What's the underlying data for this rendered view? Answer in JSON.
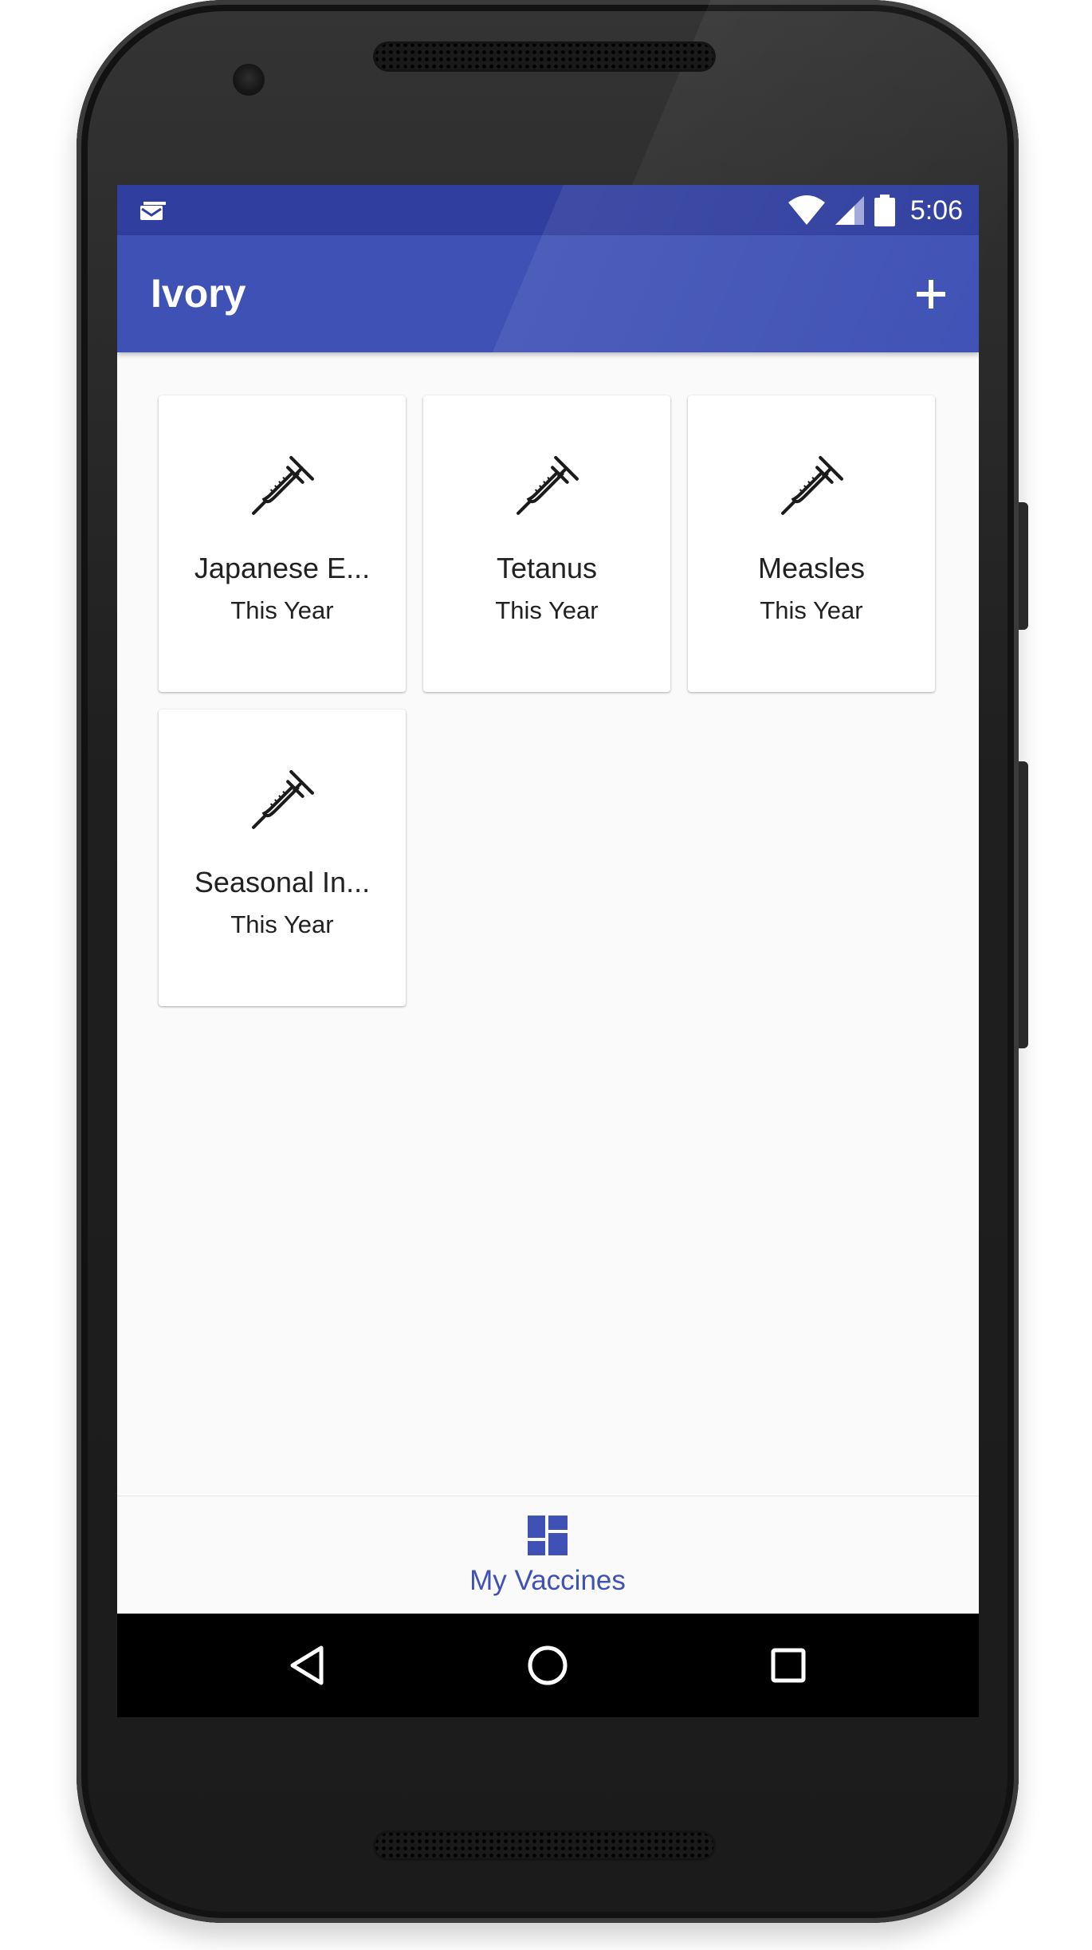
{
  "status_bar": {
    "time": "5:06",
    "icons": [
      "notification-icon",
      "wifi-icon",
      "cell-signal-icon",
      "battery-icon"
    ]
  },
  "app_bar": {
    "title": "Ivory",
    "add_icon": "plus-icon"
  },
  "vaccines": [
    {
      "name": "Japanese E...",
      "when": "This Year",
      "icon": "syringe-icon"
    },
    {
      "name": "Tetanus",
      "when": "This Year",
      "icon": "syringe-icon"
    },
    {
      "name": "Measles",
      "when": "This Year",
      "icon": "syringe-icon"
    },
    {
      "name": "Seasonal In...",
      "when": "This Year",
      "icon": "syringe-icon"
    }
  ],
  "bottom_nav": {
    "items": [
      {
        "label": "My Vaccines",
        "icon": "dashboard-icon",
        "active": true
      }
    ]
  },
  "system_nav": {
    "icons": [
      "back-icon",
      "home-icon",
      "recents-icon"
    ]
  },
  "colors": {
    "primary": "#3f51b5",
    "primary_dark": "#303f9f",
    "background": "#fafafa",
    "card": "#ffffff",
    "text": "#212121"
  }
}
